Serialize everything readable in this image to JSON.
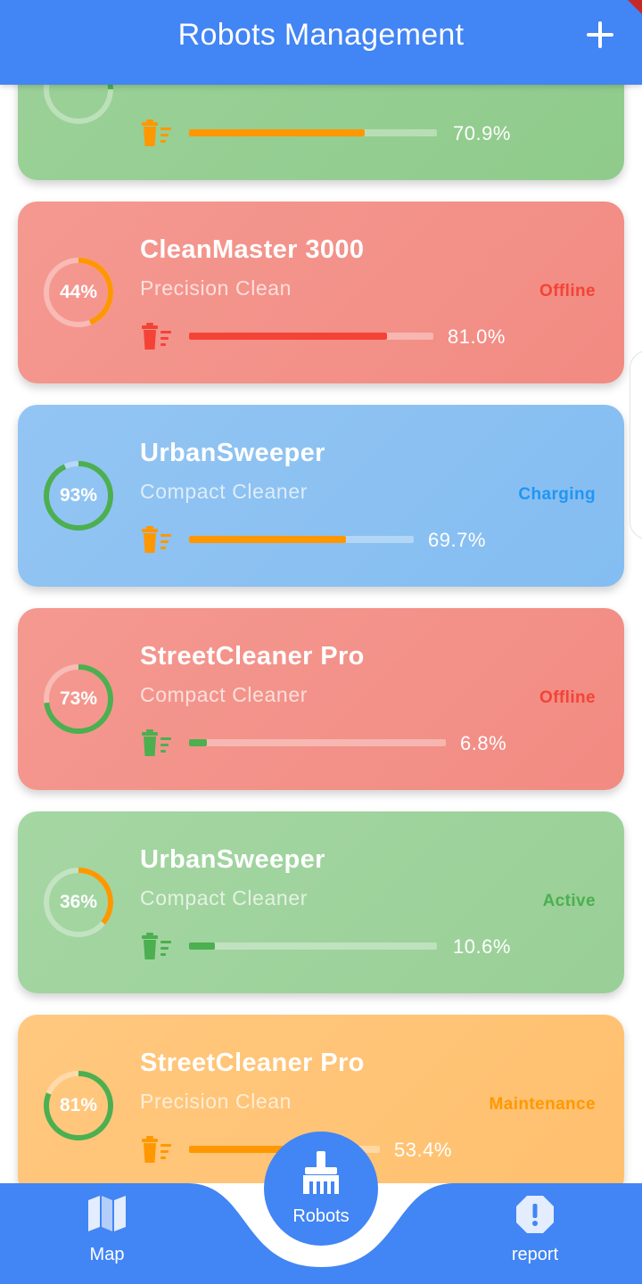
{
  "appbar": {
    "title": "Robots Management"
  },
  "robots": [
    {
      "name": "",
      "subtitle": "",
      "status": "",
      "battery": 25,
      "battery_label": "",
      "bin_percent": 70.9,
      "bin_label": "70.9%",
      "card_color": "#8fcb8b",
      "status_color": "#4caf50",
      "ring_color": "#4caf50",
      "bar_color": "#ff9800",
      "bin_icon_color": "#ff9800"
    },
    {
      "name": "CleanMaster 3000",
      "subtitle": "Precision Clean",
      "status": "Offline",
      "battery": 44,
      "battery_label": "44%",
      "bin_percent": 81.0,
      "bin_label": "81.0%",
      "card_color": "#f28b82",
      "status_color": "#f44336",
      "ring_color": "#ff9800",
      "bar_color": "#f44336",
      "bin_icon_color": "#f44336"
    },
    {
      "name": "UrbanSweeper",
      "subtitle": "Compact Cleaner",
      "status": "Charging",
      "battery": 93,
      "battery_label": "93%",
      "bin_percent": 69.7,
      "bin_label": "69.7%",
      "card_color": "#84bdf1",
      "status_color": "#2196f3",
      "ring_color": "#4caf50",
      "bar_color": "#ff9800",
      "bin_icon_color": "#ff9800"
    },
    {
      "name": "StreetCleaner Pro",
      "subtitle": "Compact Cleaner",
      "status": "Offline",
      "battery": 73,
      "battery_label": "73%",
      "bin_percent": 6.8,
      "bin_label": "6.8%",
      "card_color": "#f28b82",
      "status_color": "#f44336",
      "ring_color": "#4caf50",
      "bar_color": "#4caf50",
      "bin_icon_color": "#4caf50"
    },
    {
      "name": "UrbanSweeper",
      "subtitle": "Compact Cleaner",
      "status": "Active",
      "battery": 36,
      "battery_label": "36%",
      "bin_percent": 10.6,
      "bin_label": "10.6%",
      "card_color": "#99d097",
      "status_color": "#4caf50",
      "ring_color": "#ff9800",
      "bar_color": "#4caf50",
      "bin_icon_color": "#4caf50"
    },
    {
      "name": "StreetCleaner Pro",
      "subtitle": "Precision Clean",
      "status": "Maintenance",
      "battery": 81,
      "battery_label": "81%",
      "bin_percent": 53.4,
      "bin_label": "53.4%",
      "card_color": "#ffc06e",
      "status_color": "#ff9800",
      "ring_color": "#4caf50",
      "bar_color": "#ff9800",
      "bin_icon_color": "#ff9800"
    }
  ],
  "bottom_nav": {
    "map_label": "Map",
    "robots_label": "Robots",
    "report_label": "report",
    "map_icon": "map-icon",
    "robots_icon": "broom-icon",
    "report_icon": "alert-octagon-icon"
  },
  "colors": {
    "primary": "#4285f4"
  }
}
